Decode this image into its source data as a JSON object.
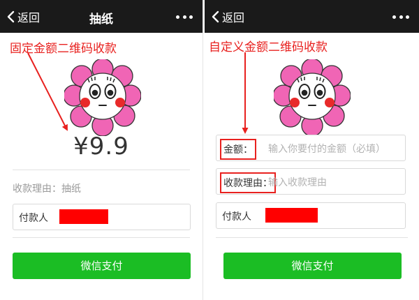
{
  "left": {
    "header": {
      "back_label": "返回",
      "title": "抽纸"
    },
    "annotation": "固定金额二维码收款",
    "amount": "¥9.9",
    "reason_text": "收款理由：抽纸",
    "payer_label": "付款人",
    "pay_button": "微信支付"
  },
  "right": {
    "header": {
      "back_label": "返回",
      "title": ""
    },
    "annotation": "自定义金额二维码收款",
    "amount_label": "金额：",
    "amount_placeholder": "输入你要付的金额（必填）",
    "reason_label": "收款理由：",
    "reason_placeholder": "输入收款理由",
    "payer_label": "付款人",
    "pay_button": "微信支付"
  },
  "colors": {
    "header_bg": "#1a1a1a",
    "annotation_red": "#e8211f",
    "pay_green": "#1bbd24",
    "redacted": "#ff0000",
    "flower_pink": "#f065b5"
  },
  "icons": [
    "chevron-left-icon",
    "more-dots-icon",
    "flower-avatar-icon"
  ]
}
